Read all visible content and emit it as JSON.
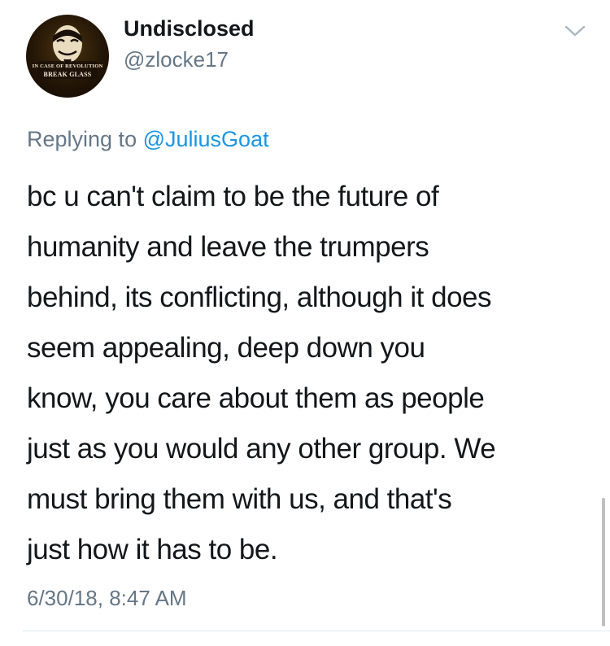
{
  "author": {
    "display_name": "Undisclosed",
    "handle": "@zlocke17",
    "avatar_caption_line1": "IN CASE OF REVOLUTION",
    "avatar_caption_line2": "BREAK GLASS"
  },
  "reply_context": {
    "prefix": "Replying to",
    "mention": "@JuliusGoat"
  },
  "tweet": {
    "text_lines": [
      "bc u can't claim to be the future of",
      "humanity and leave the trumpers",
      "behind, its conflicting, although it does",
      "seem appealing, deep down you",
      "know, you care about them as people",
      "just as you would any other group. We",
      "must bring them with us, and that's",
      "just how it has to be."
    ],
    "timestamp": "6/30/18, 8:47 AM"
  },
  "icons": {
    "menu": "chevron-down-icon"
  },
  "colors": {
    "text_primary": "#14171a",
    "text_secondary": "#657786",
    "link": "#1b95e0",
    "divider": "#e1e8ed"
  }
}
